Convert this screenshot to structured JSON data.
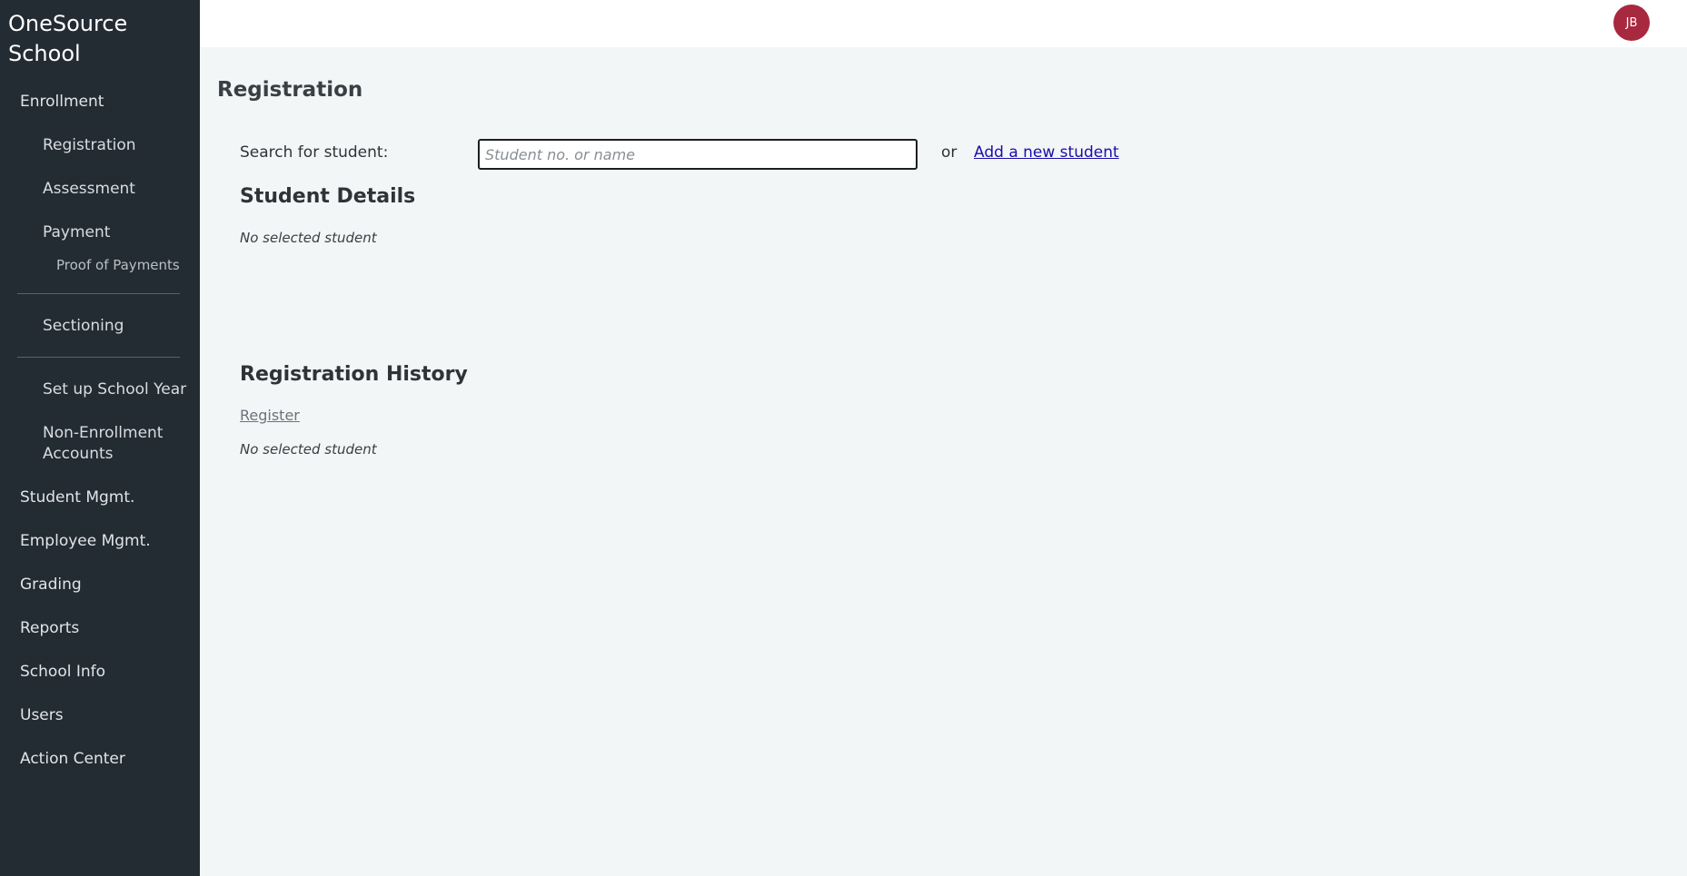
{
  "sidebar": {
    "brand": "OneSource School",
    "enrollment": "Enrollment",
    "registration": "Registration",
    "assessment": "Assessment",
    "payment": "Payment",
    "proof_of_payments": "Proof of Payments",
    "sectioning": "Sectioning",
    "setup_school_year": "Set up School Year",
    "non_enrollment_accounts": "Non-Enrollment Accounts",
    "student_mgmt": "Student Mgmt.",
    "employee_mgmt": "Employee Mgmt.",
    "grading": "Grading",
    "reports": "Reports",
    "school_info": "School Info",
    "users": "Users",
    "action_center": "Action Center"
  },
  "header": {
    "avatar_initials": "JB",
    "avatar_color": "#a8283f"
  },
  "main": {
    "page_title": "Registration",
    "search_label": "Search for student:",
    "search_placeholder": "Student no. or name",
    "search_value": "",
    "or_text": "or",
    "add_student_link": "Add a new student",
    "student_details_title": "Student Details",
    "student_details_empty": "No selected student",
    "registration_history_title": "Registration History",
    "register_link": "Register",
    "registration_history_empty": "No selected student"
  }
}
